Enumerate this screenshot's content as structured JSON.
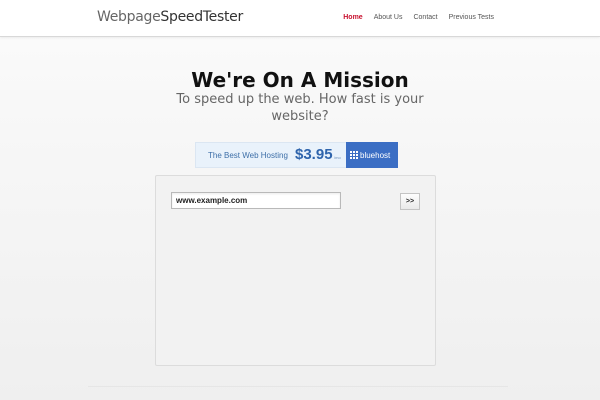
{
  "header": {
    "logo_light": "Webpage",
    "logo_bold": "SpeedTester",
    "nav": [
      "Home",
      "About Us",
      "Contact",
      "Previous Tests"
    ],
    "active_color": "#c8102e"
  },
  "hero": {
    "title": "We're On A Mission",
    "subtitle": "To speed up the web. How fast is your website?"
  },
  "ad": {
    "text": "The Best Web Hosting",
    "price": "$3.95",
    "per": "/mo",
    "brand": "bluehost",
    "brand_color": "#3b6ec4"
  },
  "tester": {
    "url_value": "www.example.com",
    "go_label": ">>"
  }
}
